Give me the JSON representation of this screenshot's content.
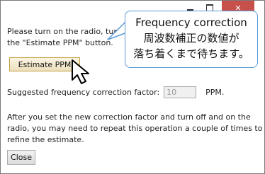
{
  "window": {
    "controls": {
      "minimize": "—",
      "maximize": "☐",
      "close": "✕"
    }
  },
  "content": {
    "intro_text": "Please turn on the radio, tune it to some FM station, and press the \"Estimate PPM\" button.",
    "estimate_button": "Estimate PPM",
    "factor_label": "Suggested frequency correction factor:",
    "factor_value": "10",
    "factor_unit": "PPM.",
    "note_text": "After you set the new correction factor and turn off and on the radio, you may need to repeat this operation a couple of times to refine the estimate.",
    "close_button": "Close"
  },
  "callout": {
    "line1": "Frequency correction",
    "line2": "周波数補正の数値が",
    "line3": "落ち着くまで待ちます。"
  },
  "colors": {
    "callout_border": "#5b9bd5",
    "close_control": "#c7504b",
    "estimate_button_border": "#c59f43"
  }
}
